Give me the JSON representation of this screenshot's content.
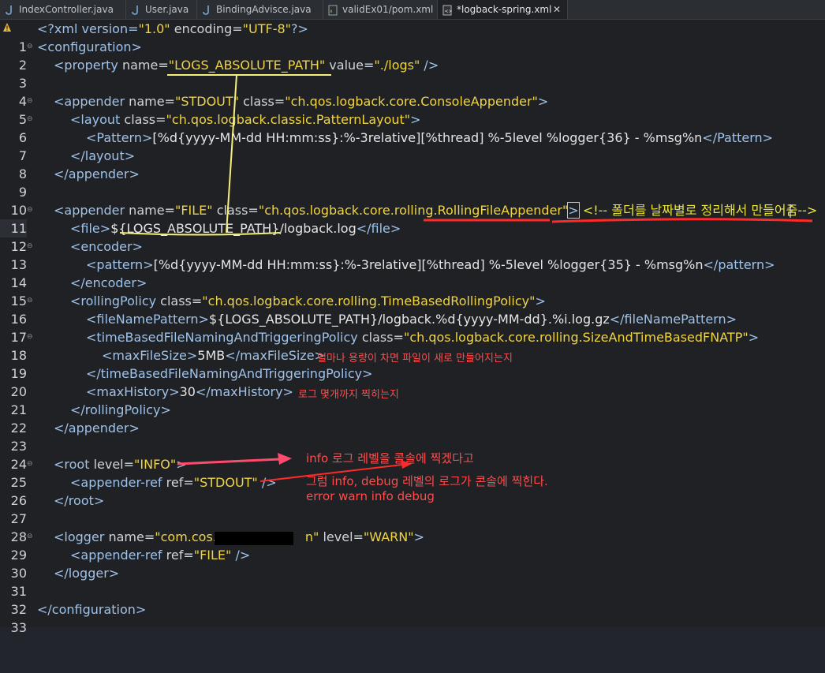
{
  "tabs": [
    {
      "label": "IndexController.java",
      "icon": "java-file-icon",
      "active": false
    },
    {
      "label": "User.java",
      "icon": "java-file-icon",
      "active": false
    },
    {
      "label": "BindingAdvisce.java",
      "icon": "java-file-icon",
      "active": false
    },
    {
      "label": "validEx01/pom.xml",
      "icon": "xml-file-icon",
      "active": false
    },
    {
      "label": "*logback-spring.xml",
      "icon": "xml-file-icon",
      "active": true
    }
  ],
  "close_glyph": "✕",
  "line_numbers": [
    "1",
    "2",
    "3",
    "4",
    "5",
    "6",
    "7",
    "8",
    "9",
    "10",
    "11",
    "12",
    "13",
    "14",
    "15",
    "16",
    "17",
    "18",
    "19",
    "20",
    "21",
    "22",
    "23",
    "24",
    "25",
    "26",
    "27",
    "28",
    "29",
    "30",
    "31",
    "32",
    "33"
  ],
  "code": {
    "l1": {
      "a": "<?xml version=",
      "b": "\"1.0\"",
      "c": " encoding=",
      "d": "\"UTF-8\"",
      "e": "?>"
    },
    "l2": {
      "a": "<configuration>"
    },
    "l3": {
      "a": "<property ",
      "b": "name=",
      "c": "\"LOGS_ABSOLUTE_PATH\"",
      "d": " value=",
      "e": "\"./logs\"",
      "f": " />"
    },
    "l5": {
      "a": "<appender ",
      "b": "name=",
      "c": "\"STDOUT\"",
      "d": " class=",
      "e": "\"ch.qos.logback.core.ConsoleAppender\"",
      "f": ">"
    },
    "l6": {
      "a": "<layout ",
      "b": "class=",
      "c": "\"ch.qos.logback.classic.PatternLayout\"",
      "d": ">"
    },
    "l7": {
      "a": "<Pattern>",
      "b": "[%d{yyyy-MM-dd HH:mm:ss}:%-3relative][%thread] %-5level %logger{36} - %msg%n",
      "c": "</Pattern>"
    },
    "l8": {
      "a": "</layout>"
    },
    "l9": {
      "a": "</appender>"
    },
    "l11": {
      "a": "<appender ",
      "b": "name=",
      "c": "\"FILE\"",
      "d": " class=",
      "e": "\"ch.qos.logback.core.rolling.RollingFileAppender\"",
      "f": ">",
      "g": " <!-- 폴더를 날짜별로 정리해서 만들어줌-->"
    },
    "l12": {
      "a": "<file>",
      "b": "${LOGS_ABSOLUTE_PATH}/logback.log",
      "c": "</file>"
    },
    "l13": {
      "a": "<encoder>"
    },
    "l14": {
      "a": "<pattern>",
      "b": "[%d{yyyy-MM-dd HH:mm:ss}:%-3relative][%thread] %-5level %logger{35} - %msg%n",
      "c": "</pattern>"
    },
    "l15": {
      "a": "</encoder>"
    },
    "l16": {
      "a": "<rollingPolicy ",
      "b": "class=",
      "c": "\"ch.qos.logback.core.rolling.TimeBasedRollingPolicy\"",
      "d": ">"
    },
    "l17": {
      "a": "<fileNamePattern>",
      "b": "${LOGS_ABSOLUTE_PATH}/logback.%d{yyyy-MM-dd}.%i.log.gz",
      "c": "</fileNamePattern>"
    },
    "l18": {
      "a": "<timeBasedFileNamingAndTriggeringPolicy ",
      "b": "class=",
      "c": "\"ch.qos.logback.core.rolling.SizeAndTimeBasedFNATP\"",
      "d": ">"
    },
    "l19": {
      "a": "<maxFileSize>",
      "b": "5MB",
      "c": "</maxFileSize>"
    },
    "l20": {
      "a": "</timeBasedFileNamingAndTriggeringPolicy>"
    },
    "l21": {
      "a": "<maxHistory>",
      "b": "30",
      "c": "</maxHistory>"
    },
    "l22": {
      "a": "</rollingPolicy>"
    },
    "l23": {
      "a": "</appender>"
    },
    "l25": {
      "a": "<root ",
      "b": "level=",
      "c": "\"INFO\"",
      "d": ">"
    },
    "l26": {
      "a": "<appender-ref ",
      "b": "ref=",
      "c": "\"STDOUT\"",
      "d": " />"
    },
    "l27": {
      "a": "</root>"
    },
    "l29": {
      "a": "<logger ",
      "b": "name=",
      "c": "\"com.cos.",
      "d": "n\"",
      "e": " level=",
      "f": "\"WARN\"",
      "g": ">"
    },
    "l30": {
      "a": "<appender-ref ",
      "b": "ref=",
      "c": "\"FILE\"",
      "d": " />"
    },
    "l31": {
      "a": "</logger>"
    },
    "l33": {
      "a": "</configuration>"
    }
  },
  "annotations": {
    "maxfilesize_note": "얼마나 용량이 차면 파일이 새로 만들어지는지",
    "maxhistory_note": "로그 몇개까지 찍히는지",
    "info_note": "info 로그 레벨을 콜솔에 찍겠다고",
    "console_note": "그럼 info, debug 레벨의 로그가 콘솔에 찍힌다.",
    "levels_note": "error warn info debug"
  },
  "colors": {
    "background": "#1f2125",
    "tag": "#9fc2e9",
    "string_value": "#f0d443",
    "comment": "#e9e33a",
    "annotation_red": "#ff3030",
    "annotation_yellow": "#f5f07a"
  }
}
